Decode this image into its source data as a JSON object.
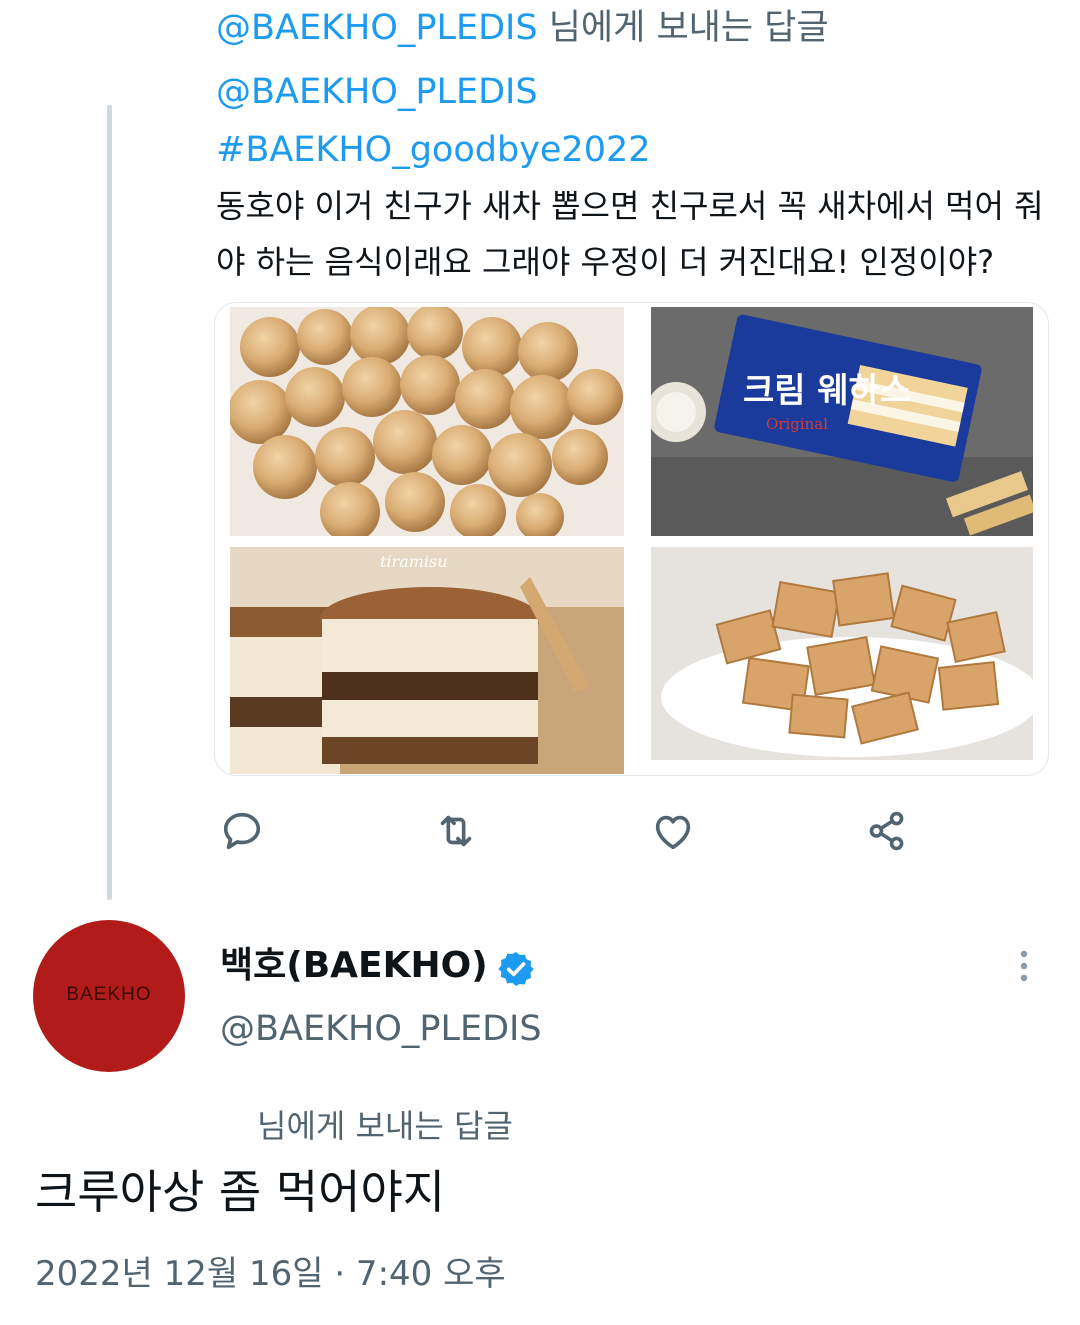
{
  "reply_context": {
    "handle": "@BAEKHO_PLEDIS",
    "suffix": " 님에게 보내는 답글"
  },
  "tweet": {
    "mention": "@BAEKHO_PLEDIS",
    "hashtag": "#BAEKHO_goodbye2022",
    "text": "동호야 이거 친구가 새차 뽑으면 친구로서 꼭 새차에서 먹어 줘야 하는 음식이래요 그래야 우정이 더 커진대요! 인정이야?",
    "media": [
      {
        "alt": "",
        "icon": "injeolmi-rice-cake-photo"
      },
      {
        "alt": "",
        "icon": "cream-wafers-photo"
      },
      {
        "alt": "",
        "icon": "tiramisu-cup-photo"
      },
      {
        "alt": "",
        "icon": "crisp-pastry-photo"
      }
    ],
    "image_captions": {
      "wafer_brand": "크림 웨하스",
      "wafer_tag": "Original",
      "tiramisu": "tiramisu"
    },
    "actions": [
      {
        "name": "reply",
        "icon": "reply-icon"
      },
      {
        "name": "retweet",
        "icon": "retweet-icon"
      },
      {
        "name": "like",
        "icon": "heart-icon"
      },
      {
        "name": "share",
        "icon": "share-icon"
      }
    ]
  },
  "reply": {
    "avatar_text": "BAEKHO",
    "display_name": "백호(BAEKHO)",
    "handle": "@BAEKHO_PLEDIS",
    "reply_label": "님에게 보내는 답글",
    "text": "크루아상 좀 먹어야지",
    "timestamp": "2022년 12월 16일 · 7:40 오후"
  },
  "colors": {
    "link": "#1d9bf0",
    "secondary": "#536471",
    "text": "#0f1419",
    "avatar_bg": "#b11c1a",
    "thread_line": "#cfd9de"
  }
}
